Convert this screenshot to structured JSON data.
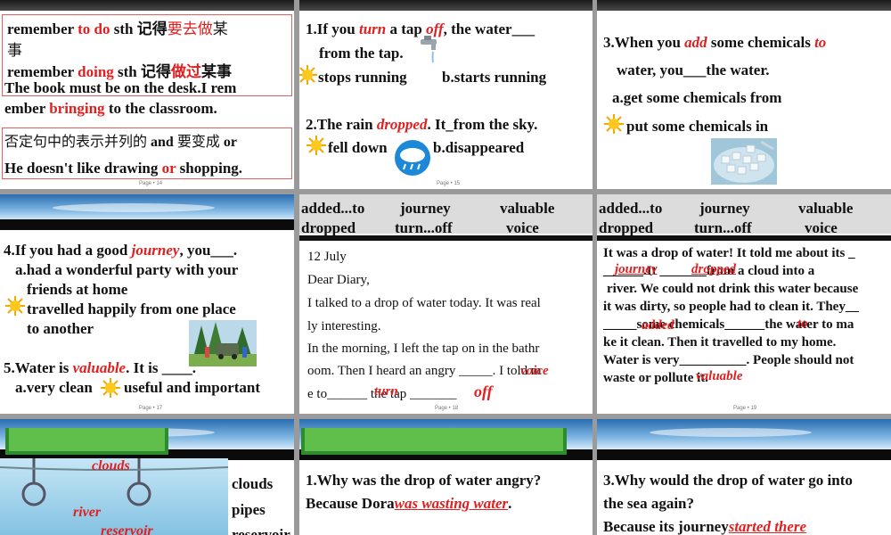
{
  "slide1": {
    "line1a": "remember ",
    "line1b": "to do",
    "line1c": " sth  记得",
    "line1d": "要去做",
    "line1e": "某",
    "line1f": "事",
    "line2a": "remember ",
    "line2b": "doing",
    "line2c": " sth  记得",
    "line2d": "做过",
    "line2e": "某事",
    "line3": "The book must be on the desk.I rem",
    "line4a": "ember ",
    "line4b": "bringing",
    "line4c": " to the classroom.",
    "line5a": "否定句中的表示并列的 ",
    "line5b": "and",
    "line5c": "  要变成 ",
    "line5d": "or",
    "line6a": "He doesn't like drawing ",
    "line6b": "or",
    "line6c": " shopping.",
    "page": "Page • 14"
  },
  "slide2": {
    "q1a": "1.If you ",
    "q1b": "turn",
    "q1c": " a tap ",
    "q1d": "off",
    "q1e": ", the water___",
    "q1f": "from the tap.",
    "q1opt_a": "stops running",
    "q1opt_b": "b.starts running",
    "q2a": "2.The rain ",
    "q2b": "dropped",
    "q2c": ". It_from the sky.",
    "q2opt_a": "fell down",
    "q2opt_b": "b.disappeared",
    "page": "Page • 15"
  },
  "slide3": {
    "q3a": "3.When you ",
    "q3b": "add",
    "q3c": " some chemicals ",
    "q3d": "to",
    "q3e": "water, you___the water.",
    "q3opt_a": "a.get some chemicals from",
    "q3opt_b": "put some chemicals in"
  },
  "slide4": {
    "q4a": "4.If you had a good ",
    "q4b": "journey",
    "q4c": ", you___.",
    "q4opt_a1": "a.had a wonderful party with your",
    "q4opt_a2": "friends at home",
    "q4opt_b1": "travelled happily from one place",
    "q4opt_b2": "to another",
    "q5a": "5.Water is ",
    "q5b": "valuable",
    "q5c": ". It is ____.",
    "q5opt_a": "a.very clean",
    "q5opt_b": "useful and important",
    "page": "Page • 17"
  },
  "words": {
    "w1": "added...to",
    "w2": "journey",
    "w3": "valuable",
    "w4": "dropped",
    "w5": "turn...off",
    "w6": "voice"
  },
  "slide5": {
    "date": "12 July",
    "greet": "Dear Diary,",
    "l1": "I talked to a drop of water today. It was real",
    "l2": "ly interesting.",
    "l3": "In the morning, I left the tap on in the bathr",
    "l4": "oom. Then I heard an angry _____. I told m",
    "l5": "e to______ the tap _______",
    "a_voice": "voice",
    "a_turn": "turn",
    "a_off": "off",
    "page": "Page • 18"
  },
  "slide6": {
    "l1": "It was a drop of water! It told me about its _",
    "l2": "______.It _______from a cloud into a",
    "l3": "river. We could not drink this water because",
    "l4": "it was dirty, so people had to clean it. They__",
    "l5": "_____some chemicals______the water to ma",
    "l6": "ke it clean. Then it travelled to my home.",
    "l7": "Water is very__________. People should not",
    "l8": "waste or pollute it.",
    "a_journey": "journey",
    "a_dropped": "dropped",
    "a_added": "added",
    "a_to": "to",
    "a_valuable": "valuable",
    "page": "Page • 19"
  },
  "slide7": {
    "clouds_red": "clouds",
    "river_red": "river",
    "reservoir_red": "reservoir",
    "w1": "clouds",
    "w2": "pipes",
    "w3": "reservoir"
  },
  "slide8": {
    "q1": "1.Why was the drop of water angry?",
    "a1a": "Because Dora",
    "a1b": "was wasting water",
    "a1c": "."
  },
  "slide9": {
    "q3a": "3.Why would the drop of water go into",
    "q3b": "the sea again?",
    "a3a": "Because its journey",
    "a3b": "started there"
  }
}
